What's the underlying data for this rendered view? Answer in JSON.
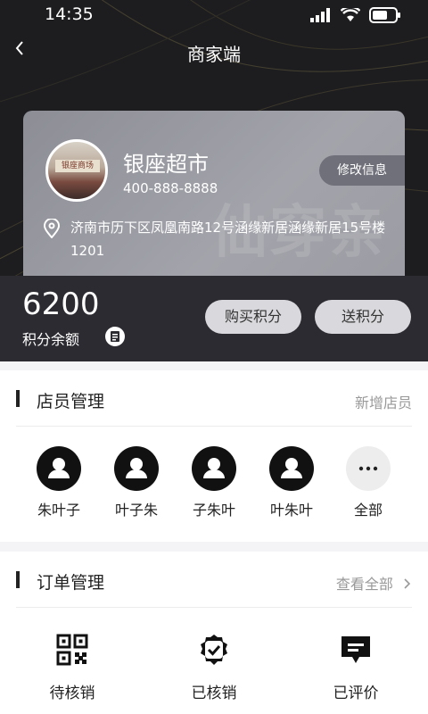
{
  "status_bar": {
    "time": "14:35"
  },
  "nav": {
    "title": "商家端"
  },
  "shop": {
    "name": "银座超市",
    "phone": "400-888-8888",
    "edit_label": "修改信息",
    "address": "济南市历下区凤凰南路12号涵缘新居涵缘新居15号楼1201",
    "watermark": "仙穿亲",
    "sign_text": "银座商场"
  },
  "points": {
    "value": "6200",
    "label": "积分余额",
    "buy_label": "购买积分",
    "send_label": "送积分"
  },
  "staff_section": {
    "title": "店员管理",
    "action": "新增店员",
    "members": [
      {
        "name": "朱叶子"
      },
      {
        "name": "叶子朱"
      },
      {
        "name": "子朱叶"
      },
      {
        "name": "叶朱叶"
      }
    ],
    "more_label": "全部"
  },
  "order_section": {
    "title": "订单管理",
    "action": "查看全部",
    "items": [
      {
        "label": "待核销",
        "icon": "qr-code-icon"
      },
      {
        "label": "已核销",
        "icon": "verified-badge-icon"
      },
      {
        "label": "已评价",
        "icon": "comment-icon"
      }
    ]
  },
  "colors": {
    "hero_bg": "#1d1d20",
    "card_bg": "#9a9ba2",
    "points_bg": "#2b2b31",
    "accent": "#222222"
  }
}
